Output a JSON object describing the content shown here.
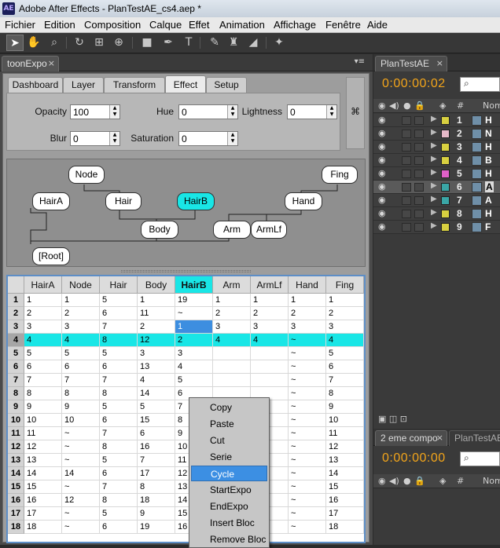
{
  "window": {
    "title": "Adobe After Effects - PlanTestAE_cs4.aep *",
    "app_icon": "AE"
  },
  "menu": [
    "Fichier",
    "Edition",
    "Composition",
    "Calque",
    "Effet",
    "Animation",
    "Affichage",
    "Fenêtre",
    "Aide"
  ],
  "toolbar": {
    "tools": [
      "selection-tool-icon",
      "hand-tool-icon",
      "zoom-tool-icon",
      "rotate-tool-icon",
      "camera-tool-icon",
      "pan-behind-tool-icon",
      "rectangle-tool-icon",
      "pen-tool-icon",
      "text-tool-icon",
      "brush-tool-icon",
      "clone-stamp-tool-icon",
      "eraser-tool-icon",
      "puppet-pin-tool-icon"
    ]
  },
  "left_panel": {
    "tab": "toonExpo",
    "tab_close": "×",
    "menu_icon": "▾≡",
    "props_tabs": [
      "Dashboard",
      "Layer",
      "Transform",
      "Effect",
      "Setup"
    ],
    "active_tab": "Effect",
    "fields": {
      "opacity": {
        "label": "Opacity",
        "value": "100"
      },
      "hue": {
        "label": "Hue",
        "value": "0"
      },
      "lightness": {
        "label": "Lightness",
        "value": "0"
      },
      "blur": {
        "label": "Blur",
        "value": "0"
      },
      "saturation": {
        "label": "Saturation",
        "value": "0"
      }
    },
    "nodes": {
      "node": "Node",
      "fing": "Fing",
      "hair_a": "HairA",
      "hair": "Hair",
      "hair_b": "HairB",
      "hand": "Hand",
      "body": "Body",
      "arm": "Arm",
      "arm_lf": "ArmLf",
      "root": "[Root]"
    },
    "grid": {
      "columns": [
        "HairA",
        "Node",
        "Hair",
        "Body",
        "HairB",
        "Arm",
        "ArmLf",
        "Hand",
        "Fing"
      ],
      "selected_column": "HairB",
      "rows": [
        [
          "1",
          "1",
          "5",
          "1",
          "19",
          "1",
          "1",
          "1",
          "1"
        ],
        [
          "2",
          "2",
          "6",
          "11",
          "~",
          "2",
          "2",
          "2",
          "2"
        ],
        [
          "3",
          "3",
          "7",
          "2",
          "1",
          "3",
          "3",
          "3",
          "3"
        ],
        [
          "4",
          "4",
          "8",
          "12",
          "2",
          "4",
          "4",
          "~",
          "4"
        ],
        [
          "5",
          "5",
          "5",
          "3",
          "3",
          "",
          "",
          "~",
          "5"
        ],
        [
          "6",
          "6",
          "6",
          "13",
          "4",
          "",
          "",
          "~",
          "6"
        ],
        [
          "7",
          "7",
          "7",
          "4",
          "5",
          "",
          "",
          "~",
          "7"
        ],
        [
          "8",
          "8",
          "8",
          "14",
          "6",
          "",
          "",
          "~",
          "8"
        ],
        [
          "9",
          "9",
          "5",
          "5",
          "7",
          "",
          "",
          "~",
          "9"
        ],
        [
          "10",
          "10",
          "6",
          "15",
          "8",
          "",
          "",
          "~",
          "10"
        ],
        [
          "11",
          "~",
          "7",
          "6",
          "9",
          "",
          "",
          "~",
          "11"
        ],
        [
          "12",
          "~",
          "8",
          "16",
          "10",
          "",
          "",
          "~",
          "12"
        ],
        [
          "13",
          "~",
          "5",
          "7",
          "11",
          "",
          "",
          "~",
          "13"
        ],
        [
          "14",
          "14",
          "6",
          "17",
          "12",
          "",
          "",
          "~",
          "14"
        ],
        [
          "15",
          "~",
          "7",
          "8",
          "13",
          "9",
          "9",
          "~",
          "15"
        ],
        [
          "16",
          "12",
          "8",
          "18",
          "14",
          "10",
          "10",
          "~",
          "16"
        ],
        [
          "17",
          "~",
          "5",
          "9",
          "15",
          "8",
          "8",
          "~",
          "17"
        ],
        [
          "18",
          "~",
          "6",
          "19",
          "16",
          "9",
          "9",
          "~",
          "18"
        ]
      ]
    },
    "context_menu": [
      "Copy",
      "Paste",
      "Cut",
      "Serie",
      "Cycle",
      "StartExpo",
      "EndExpo",
      "Insert Bloc",
      "Remove Bloc"
    ],
    "context_hover": "Cycle"
  },
  "right_panel": {
    "tab1": "PlanTestAE",
    "tab1_close": "×",
    "timecode1": "0:00:00:02",
    "search_icon": "⌕",
    "col_hash": "#",
    "col_name": "Nom",
    "layers": [
      {
        "num": "1",
        "color": "#d8d040",
        "name": "H"
      },
      {
        "num": "2",
        "color": "#e6b8c8",
        "name": "N"
      },
      {
        "num": "3",
        "color": "#d8d040",
        "name": "H"
      },
      {
        "num": "4",
        "color": "#d8d040",
        "name": "B"
      },
      {
        "num": "5",
        "color": "#e060c8",
        "name": "H"
      },
      {
        "num": "6",
        "color": "#3aa6a6",
        "name": "A"
      },
      {
        "num": "7",
        "color": "#3aa6a6",
        "name": "A"
      },
      {
        "num": "8",
        "color": "#d8d040",
        "name": "H"
      },
      {
        "num": "9",
        "color": "#d8d040",
        "name": "F"
      }
    ],
    "selected_layer": "6",
    "tab2": "2 eme compo",
    "tab2_close": "×",
    "tab3": "PlanTestAE",
    "timecode2": "0:00:00:00"
  },
  "colors": {
    "accent_cyan": "#19e6e6",
    "timecode_orange": "#f3a51a",
    "selection_blue": "#3d8ee0"
  }
}
